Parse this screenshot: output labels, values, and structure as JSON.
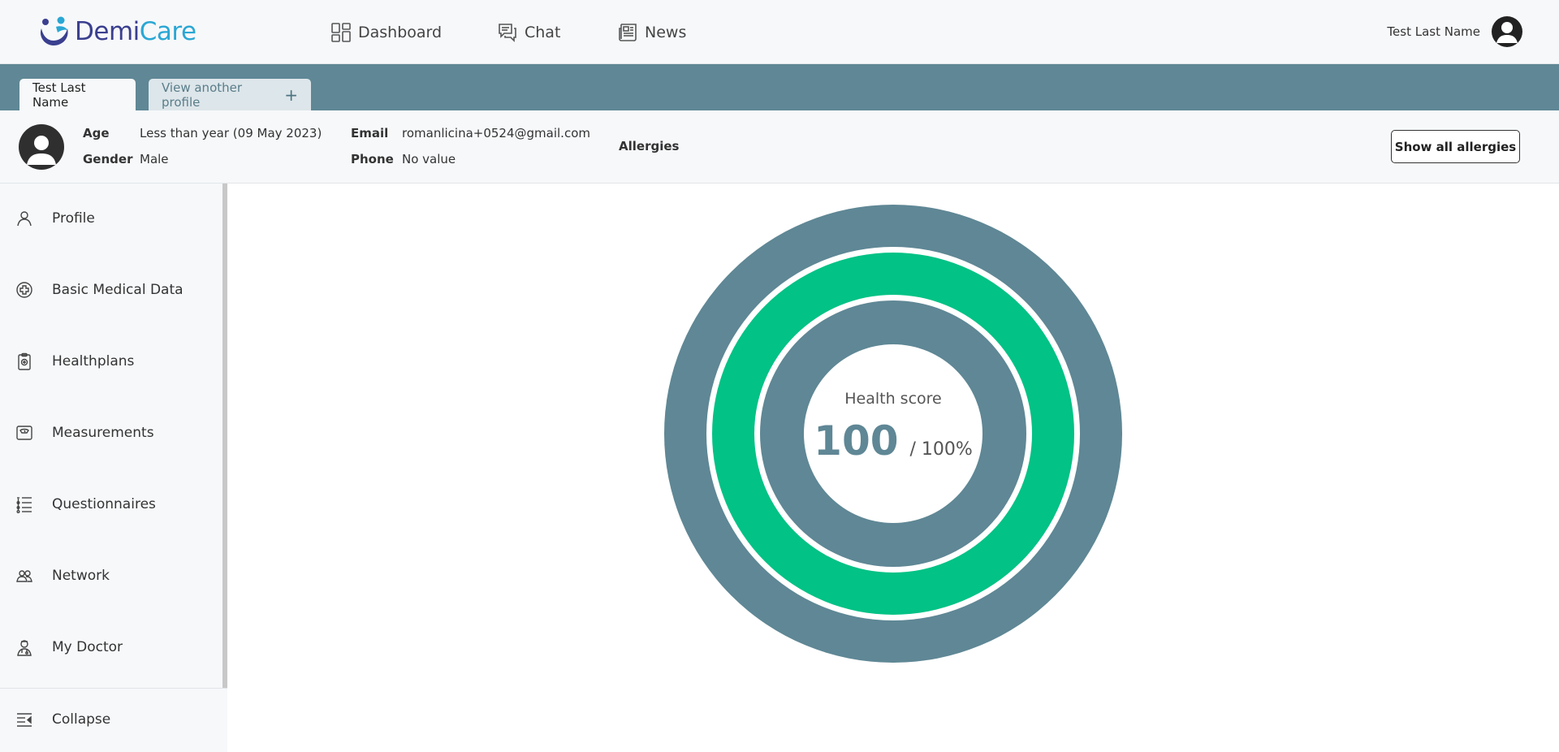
{
  "app": {
    "logo_part1": "Demi",
    "logo_part2": "Care",
    "brand_colors": {
      "primary": "#5f8795",
      "accent": "#02c285",
      "logo_dark": "#3a3f8f",
      "logo_light": "#2aa7d4"
    }
  },
  "nav": {
    "dashboard": "Dashboard",
    "chat": "Chat",
    "news": "News"
  },
  "user": {
    "name": "Test Last Name"
  },
  "tabs": {
    "active": "Test Last Name",
    "other": "View another profile",
    "other_icon": "+"
  },
  "profile": {
    "age_label": "Age",
    "age_value": "Less than year (09 May 2023)",
    "gender_label": "Gender",
    "gender_value": "Male",
    "email_label": "Email",
    "email_value": "romanlicina+0524@gmail.com",
    "phone_label": "Phone",
    "phone_value": "No value",
    "allergies_label": "Allergies",
    "show_allergies_button": "Show all allergies"
  },
  "sidebar": {
    "items": [
      {
        "label": "Profile",
        "icon": "person-icon"
      },
      {
        "label": "Basic Medical Data",
        "icon": "medical-cross-icon"
      },
      {
        "label": "Healthplans",
        "icon": "clipboard-icon"
      },
      {
        "label": "Measurements",
        "icon": "scale-icon"
      },
      {
        "label": "Questionnaires",
        "icon": "list-icon"
      },
      {
        "label": "Network",
        "icon": "people-icon"
      },
      {
        "label": "My Doctor",
        "icon": "doctor-icon"
      }
    ],
    "collapse_label": "Collapse"
  },
  "health_score": {
    "title": "Health score",
    "value": "100",
    "max": "/ 100%",
    "fill_fraction": 1.0
  }
}
